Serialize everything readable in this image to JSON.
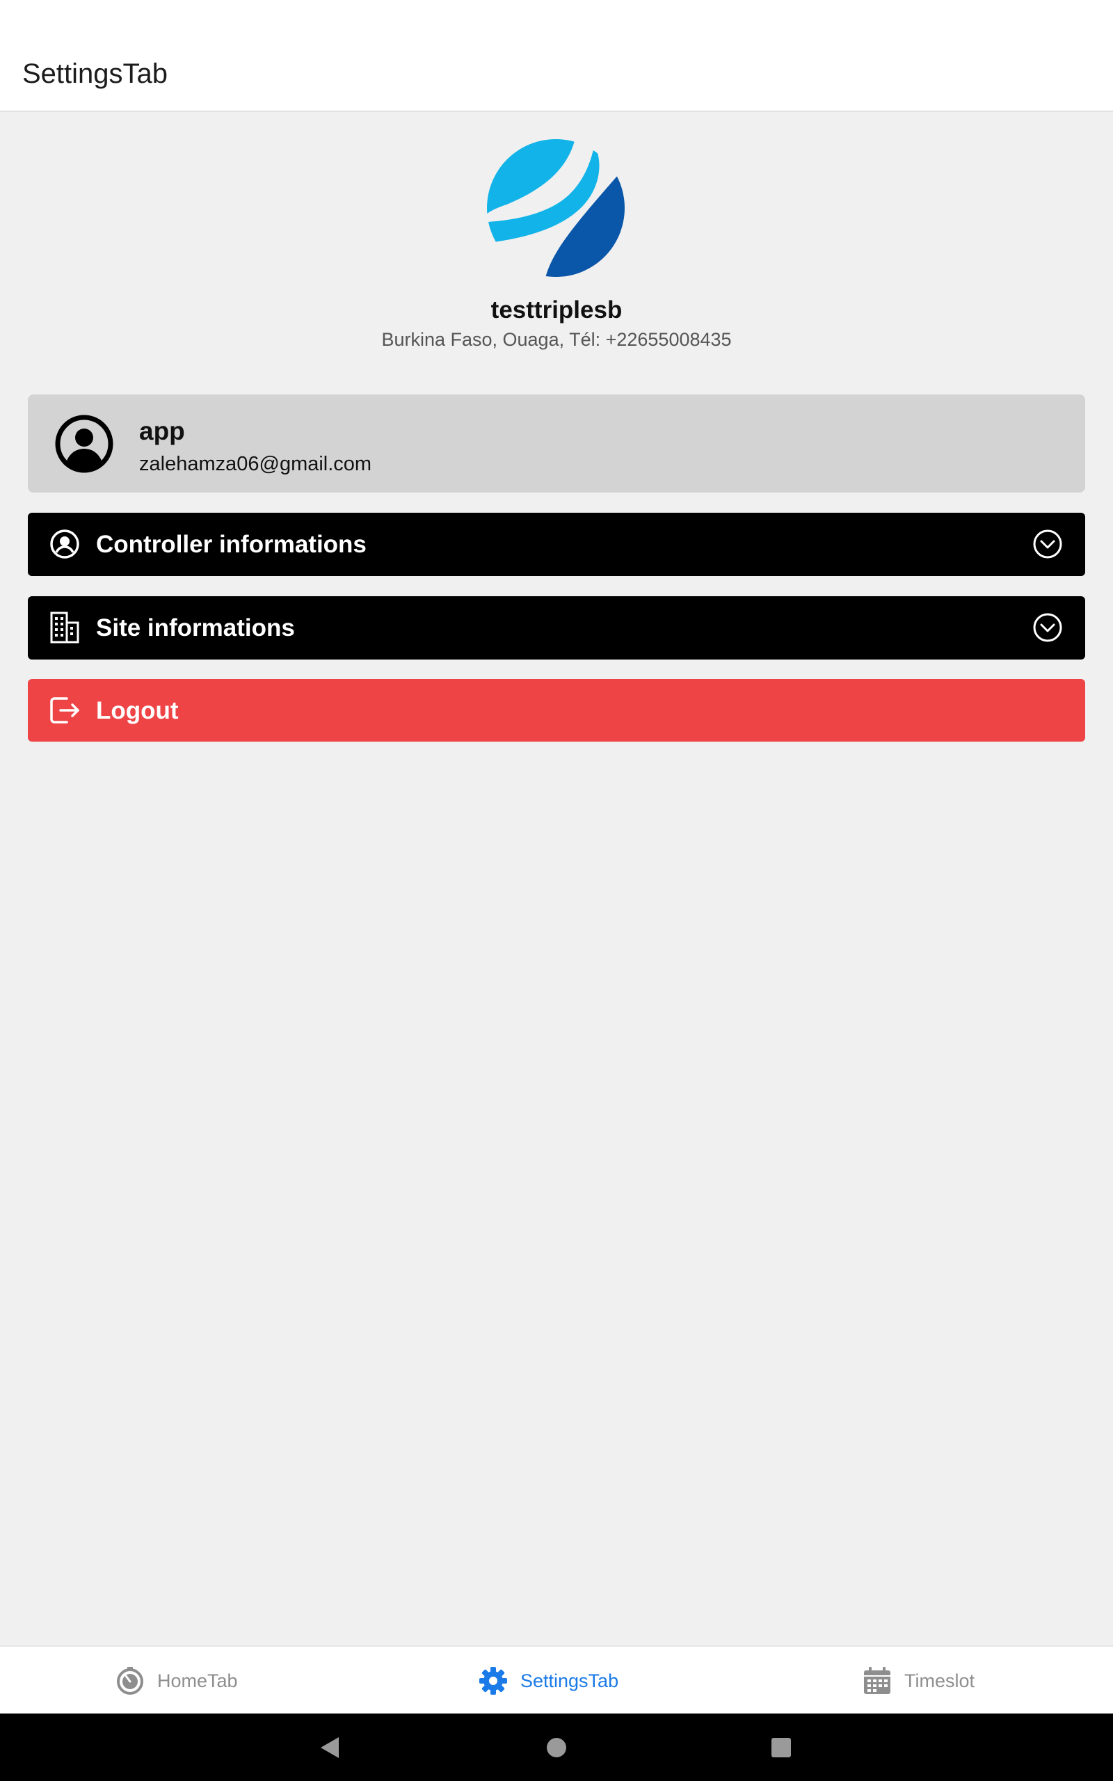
{
  "header": {
    "title": "SettingsTab"
  },
  "company": {
    "name": "testtriplesb",
    "address": "Burkina Faso, Ouaga, Tél: +22655008435",
    "logo_colors": [
      "#12b3e8",
      "#0a56a8"
    ]
  },
  "user": {
    "name": "app",
    "email": "zalehamza06@gmail.com",
    "icon": "account-circle-icon"
  },
  "sections": {
    "controller": {
      "label": "Controller informations",
      "icon": "user-circle-icon",
      "chevron": "chevron-down-circle-icon"
    },
    "site": {
      "label": "Site informations",
      "icon": "building-icon",
      "chevron": "chevron-down-circle-icon"
    },
    "logout": {
      "label": "Logout",
      "icon": "logout-icon",
      "color": "#ef4446"
    }
  },
  "tabs": [
    {
      "label": "HomeTab",
      "icon": "timer-icon",
      "active": false
    },
    {
      "label": "SettingsTab",
      "icon": "gear-icon",
      "active": true
    },
    {
      "label": "Timeslot",
      "icon": "calendar-icon",
      "active": false
    }
  ],
  "colors": {
    "active_tab": "#1a7ae8",
    "inactive_tab": "#8e8e8e",
    "section_bg": "#000000",
    "user_card_bg": "#d3d3d3"
  },
  "system_nav": [
    "back-icon",
    "home-icon",
    "recents-icon"
  ]
}
